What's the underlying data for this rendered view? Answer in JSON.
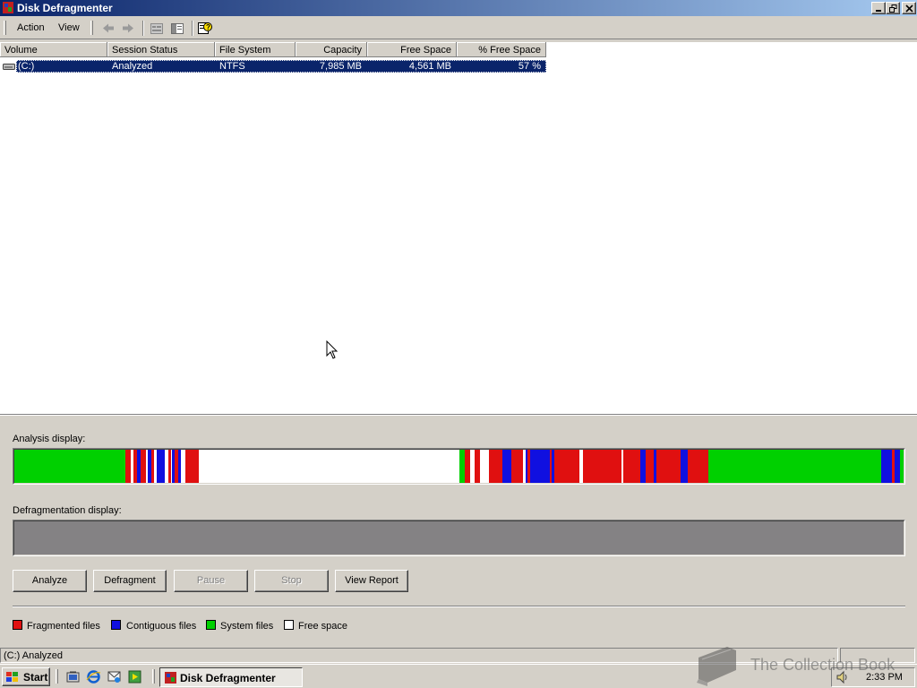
{
  "window": {
    "title": "Disk Defragmenter"
  },
  "menu": {
    "items": [
      "Action",
      "View"
    ]
  },
  "toolbar": {
    "icons": [
      "back-arrow-icon",
      "forward-arrow-icon",
      "properties-icon",
      "show-hide-console-tree-icon",
      "help-icon"
    ]
  },
  "volumes": {
    "columns": [
      "Volume",
      "Session Status",
      "File System",
      "Capacity",
      "Free Space",
      "% Free Space"
    ],
    "rows": [
      {
        "volume": "(C:)",
        "session_status": "Analyzed",
        "file_system": "NTFS",
        "capacity": "7,985 MB",
        "free_space": "4,561 MB",
        "pct_free": "57 %"
      }
    ]
  },
  "analysis": {
    "label": "Analysis display:",
    "segment_colors": {
      "fragmented": "#e01010",
      "contiguous": "#1010e0",
      "system": "#00d000",
      "free": "#ffffff"
    }
  },
  "defrag": {
    "label": "Defragmentation display:",
    "fill_color": "#848284"
  },
  "buttons": {
    "analyze": "Analyze",
    "defragment": "Defragment",
    "pause": "Pause",
    "stop": "Stop",
    "view_report": "View Report"
  },
  "legend": {
    "fragmented": "Fragmented files",
    "contiguous": "Contiguous files",
    "system": "System files",
    "free": "Free space"
  },
  "status_bar": {
    "text": "(C:) Analyzed"
  },
  "taskbar": {
    "start": "Start",
    "task": "Disk Defragmenter",
    "clock": "2:33 PM"
  },
  "watermark": {
    "text": "The Collection Book"
  }
}
